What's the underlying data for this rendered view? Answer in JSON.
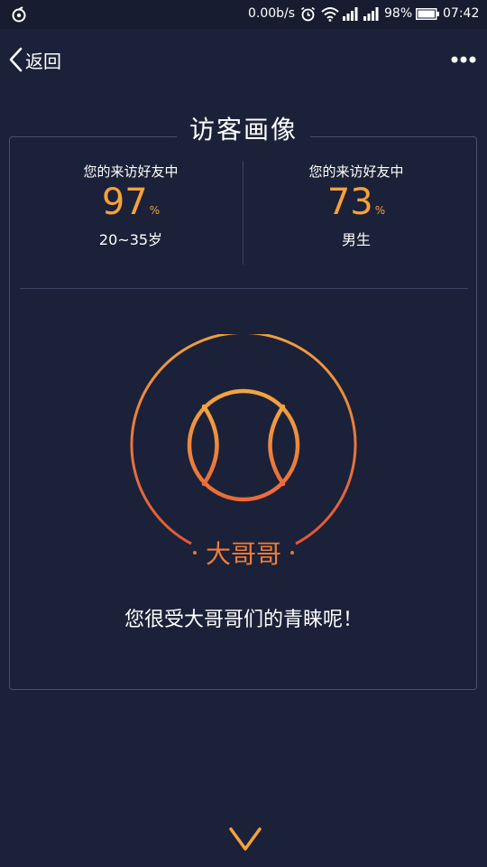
{
  "status_bar": {
    "net_speed": "0.00b/s",
    "battery_percent": "98%",
    "time": "07:42",
    "icons": [
      "app-icon",
      "alarm-icon",
      "wifi-icon",
      "signal-icon",
      "signal-icon",
      "battery-icon"
    ]
  },
  "nav": {
    "back_label": "返回",
    "more_icon": "more-dots-icon"
  },
  "card": {
    "title": "访客画像",
    "stats": [
      {
        "label": "您的来访好友中",
        "value": "97",
        "unit": "%",
        "desc": "20~35岁"
      },
      {
        "label": "您的来访好友中",
        "value": "73",
        "unit": "%",
        "desc": "男生"
      }
    ],
    "emblem_icon": "basketball-icon",
    "emblem_label": "大哥哥",
    "message": "您很受大哥哥们的青睐呢！"
  },
  "footer": {
    "scroll_icon": "chevron-down-icon"
  },
  "colors": {
    "background": "#1b2138",
    "accent": "#f5a23a",
    "accent_orange": "#ef7d3c",
    "border": "#4a5170"
  }
}
